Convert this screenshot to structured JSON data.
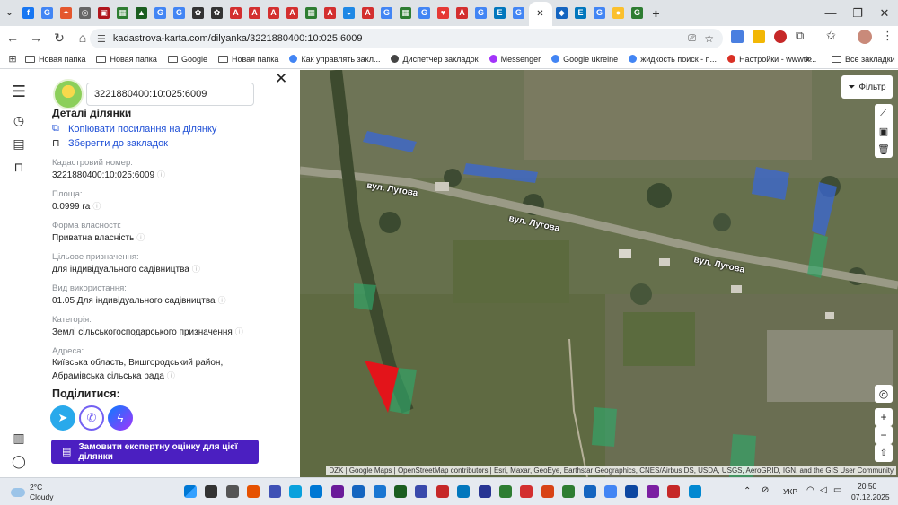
{
  "browser": {
    "tab_icons": [
      {
        "name": "facebook-icon",
        "color": "#1877f2",
        "glyph": "f"
      },
      {
        "name": "google-icon",
        "color": "#4285f4",
        "glyph": "G"
      },
      {
        "name": "pin-icon",
        "color": "#e4572e",
        "glyph": "✦"
      },
      {
        "name": "globe-icon",
        "color": "#666666",
        "glyph": "◎"
      },
      {
        "name": "app-icon",
        "color": "#b0161d",
        "glyph": "▣"
      },
      {
        "name": "sheet-icon",
        "color": "#2e7d32",
        "glyph": "▦"
      },
      {
        "name": "hat-icon",
        "color": "#1b5e20",
        "glyph": "▲"
      },
      {
        "name": "google-icon",
        "color": "#4285f4",
        "glyph": "G"
      },
      {
        "name": "google-icon",
        "color": "#4285f4",
        "glyph": "G"
      },
      {
        "name": "openai-icon",
        "color": "#333333",
        "glyph": "✿"
      },
      {
        "name": "openai-icon",
        "color": "#333333",
        "glyph": "✿"
      },
      {
        "name": "pdf-icon",
        "color": "#d32f2f",
        "glyph": "A"
      },
      {
        "name": "pdf-icon",
        "color": "#d32f2f",
        "glyph": "A"
      },
      {
        "name": "pdf-icon",
        "color": "#d32f2f",
        "glyph": "A"
      },
      {
        "name": "pdf-icon",
        "color": "#d32f2f",
        "glyph": "A"
      },
      {
        "name": "sheet-icon",
        "color": "#2e7d32",
        "glyph": "▦"
      },
      {
        "name": "pdf-icon",
        "color": "#d32f2f",
        "glyph": "A"
      },
      {
        "name": "edge-icon",
        "color": "#1e88e5",
        "glyph": "◒"
      },
      {
        "name": "pdf-icon",
        "color": "#d32f2f",
        "glyph": "A"
      },
      {
        "name": "google-icon",
        "color": "#4285f4",
        "glyph": "G"
      },
      {
        "name": "sheet-icon",
        "color": "#2e7d32",
        "glyph": "▦"
      },
      {
        "name": "google-icon",
        "color": "#4285f4",
        "glyph": "G"
      },
      {
        "name": "heart-icon",
        "color": "#e53935",
        "glyph": "♥"
      },
      {
        "name": "pdf-icon",
        "color": "#d32f2f",
        "glyph": "A"
      },
      {
        "name": "google-icon",
        "color": "#4285f4",
        "glyph": "G"
      },
      {
        "name": "e-icon",
        "color": "#0277bd",
        "glyph": "E"
      },
      {
        "name": "google-icon",
        "color": "#4285f4",
        "glyph": "G"
      }
    ],
    "active_tab_close": "✕",
    "tail_icons": [
      {
        "name": "bird-icon",
        "color": "#1565c0",
        "glyph": "◆"
      },
      {
        "name": "e-icon",
        "color": "#0277bd",
        "glyph": "E"
      },
      {
        "name": "google-icon",
        "color": "#4285f4",
        "glyph": "G"
      },
      {
        "name": "maps-pin-icon",
        "color": "#fbc02d",
        "glyph": "●"
      },
      {
        "name": "green-g-icon",
        "color": "#2e7d32",
        "glyph": "G"
      }
    ],
    "new_tab": "+",
    "url": "kadastrova-karta.com/dilyanka/3221880400:10:025:6009",
    "bookmarks": [
      {
        "label": "Новая папка",
        "type": "folder"
      },
      {
        "label": "Новая папка",
        "type": "folder"
      },
      {
        "label": "Google",
        "type": "folder"
      },
      {
        "label": "Новая папка",
        "type": "folder"
      },
      {
        "label": "Как управлять закл...",
        "type": "google"
      },
      {
        "label": "Диспетчер закладок",
        "type": "star"
      },
      {
        "label": "Messenger",
        "type": "messenger"
      },
      {
        "label": "Google ukreine",
        "type": "google"
      },
      {
        "label": "жидкость поиск - п...",
        "type": "google"
      },
      {
        "label": "Настройки - wwwtk...",
        "type": "gmail"
      }
    ],
    "bookmarks_more": "»",
    "all_bookmarks": "Все закладки"
  },
  "panel": {
    "search_value": "3221880400:10:025:6009",
    "heading": "Деталі ділянки",
    "copy_link": "Копіювати посилання на ділянку",
    "save_bookmark": "Зберегти до закладок",
    "fields": [
      {
        "label": "Кадастровий номер:",
        "value": "3221880400:10:025:6009"
      },
      {
        "label": "Площа:",
        "value": "0.0999 га"
      },
      {
        "label": "Форма власності:",
        "value": "Приватна власність"
      },
      {
        "label": "Цільове призначення:",
        "value": "для індивідуального садівництва"
      },
      {
        "label": "Вид використання:",
        "value": "01.05 Для індивідуального садівництва"
      },
      {
        "label": "Категорія:",
        "value": "Землі сільськогосподарського призначення"
      },
      {
        "label": "Адреса:",
        "value": "Київська область, Вишгородський район, Абрамівська сільська рада"
      }
    ],
    "share_title": "Поділитися:",
    "order_button": "Замовити експертну оцінку для цієї ділянки"
  },
  "map": {
    "filter": "Фільтр",
    "street_label": "вул. Лугова",
    "attribution": "DZK | Google Maps | OpenStreetMap contributors | Esri, Maxar, GeoEye, Earthstar Geographics, CNES/Airbus DS, USDA, USGS, AeroGRID, IGN, and the GIS User Community",
    "colors": {
      "selected": "#e3141a",
      "parcel_blue": "#3a67d6",
      "parcel_green": "#2fa86a"
    }
  },
  "taskbar": {
    "temp": "2°C",
    "condition": "Cloudy",
    "lang": "УКР",
    "time": "20:50",
    "date": "07.12.2025"
  }
}
